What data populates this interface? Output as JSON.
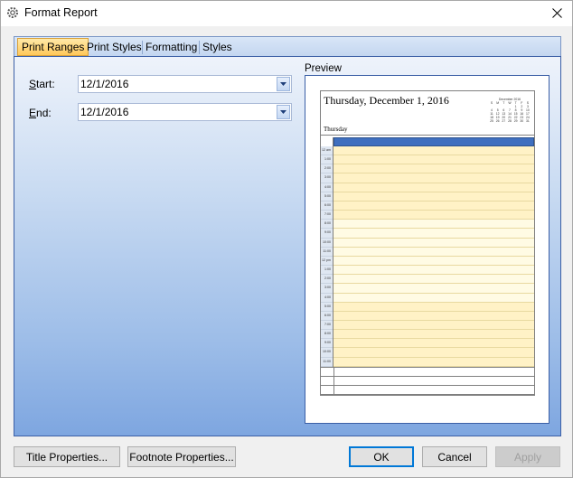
{
  "window": {
    "title": "Format Report"
  },
  "tabs": [
    {
      "label": "Print Ranges",
      "active": true
    },
    {
      "label": "Print Styles",
      "active": false
    },
    {
      "label": "Formatting",
      "active": false
    },
    {
      "label": "Styles",
      "active": false
    }
  ],
  "ranges": {
    "start_label_u": "S",
    "start_label_rest": "tart:",
    "start_value": "12/1/2016",
    "end_label_u": "E",
    "end_label_rest": "nd:",
    "end_value": "12/1/2016"
  },
  "preview": {
    "label": "Preview",
    "page_title": "Thursday, December 1, 2016",
    "day_label": "Thursday",
    "mini_calendar": {
      "title": "December 2016",
      "weekdays": [
        "S",
        "M",
        "T",
        "W",
        "T",
        "F",
        "S"
      ],
      "weeks": [
        [
          "",
          "",
          "",
          "",
          "1",
          "2",
          "3"
        ],
        [
          "4",
          "5",
          "6",
          "7",
          "8",
          "9",
          "10"
        ],
        [
          "11",
          "12",
          "13",
          "14",
          "15",
          "16",
          "17"
        ],
        [
          "18",
          "19",
          "20",
          "21",
          "22",
          "23",
          "24"
        ],
        [
          "25",
          "26",
          "27",
          "28",
          "29",
          "30",
          "31"
        ]
      ]
    },
    "hours": [
      "12 am",
      "1:00",
      "2:00",
      "3:00",
      "4:00",
      "5:00",
      "6:00",
      "7:00",
      "8:00",
      "9:00",
      "10:00",
      "11:00",
      "12 pm",
      "1:00",
      "2:00",
      "3:00",
      "4:00",
      "5:00",
      "6:00",
      "7:00",
      "8:00",
      "9:00",
      "10:00",
      "11:00"
    ]
  },
  "buttons": {
    "title_properties": "Title Properties...",
    "footnote_properties": "Footnote Properties...",
    "ok": "OK",
    "cancel": "Cancel",
    "apply": "Apply"
  },
  "colors": {
    "accent": "#3f6fbf",
    "active_tab": "#ffc85a",
    "slot_off": "#fff2c6",
    "slot_on": "#fffbe4"
  }
}
